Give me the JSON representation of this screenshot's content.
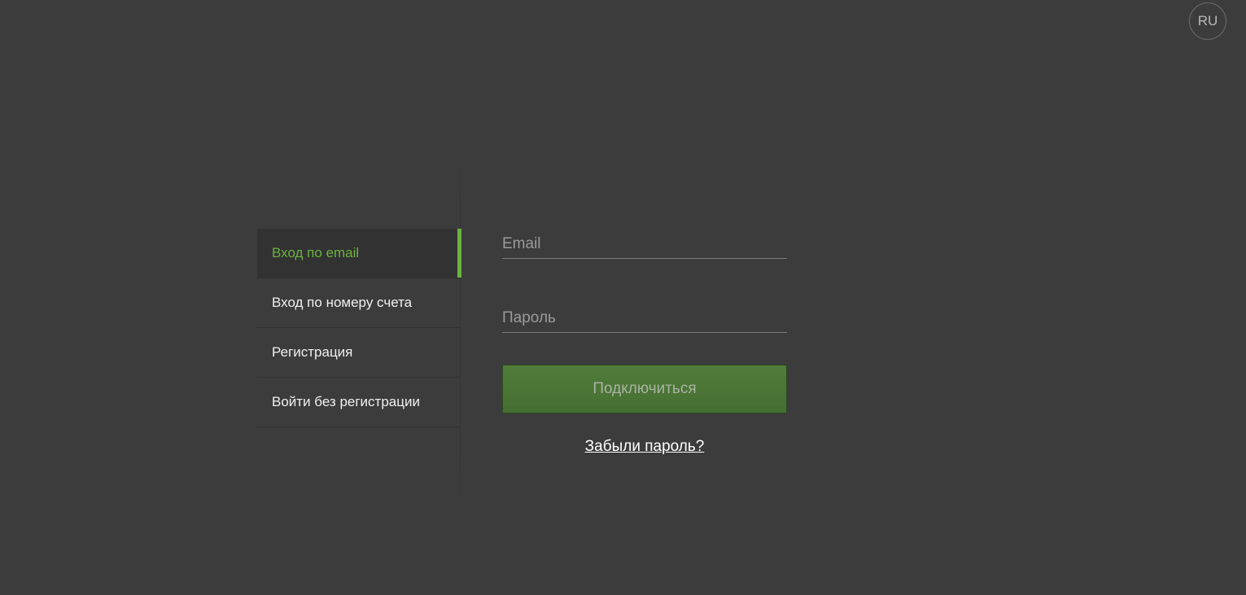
{
  "header": {
    "language_label": "RU"
  },
  "tabs": [
    {
      "label": "Вход по email",
      "active": true
    },
    {
      "label": "Вход по номеру счета",
      "active": false
    },
    {
      "label": "Регистрация",
      "active": false
    },
    {
      "label": "Войти без регистрации",
      "active": false
    }
  ],
  "form": {
    "email": {
      "placeholder": "Email",
      "value": ""
    },
    "password": {
      "placeholder": "Пароль",
      "value": ""
    },
    "submit_label": "Подключиться",
    "forgot_label": "Забыли пароль?"
  },
  "colors": {
    "background": "#3c3c3c",
    "accent": "#6cb33f",
    "button": "#4b7635"
  }
}
